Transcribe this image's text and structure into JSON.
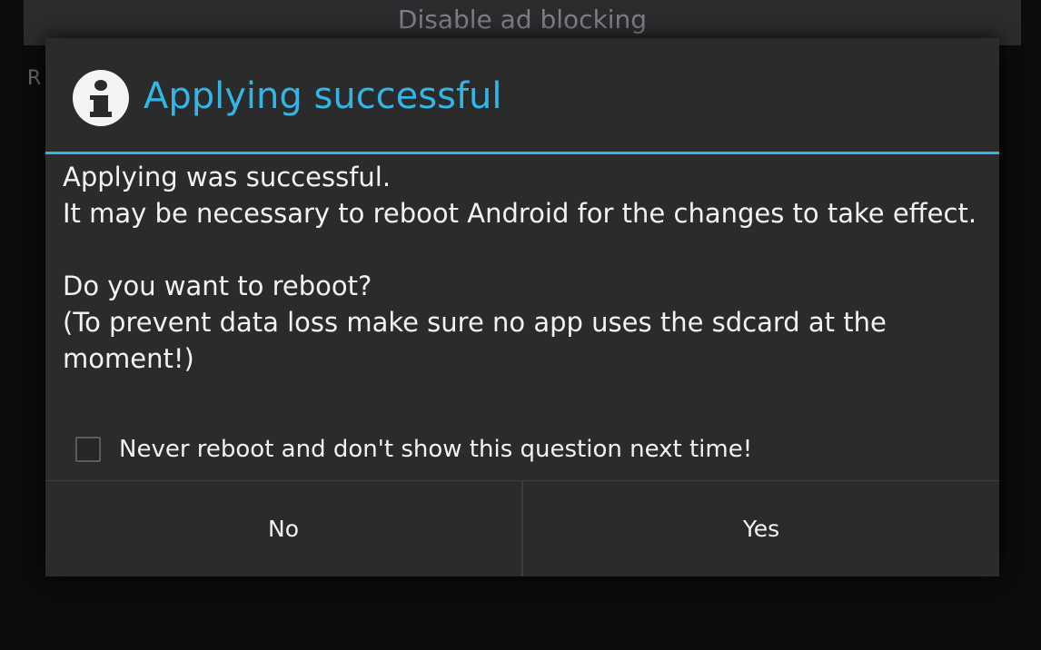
{
  "background": {
    "top_button_label": "Disable ad blocking",
    "partial_label": "R"
  },
  "dialog": {
    "icon": "info-icon",
    "title": "Applying successful",
    "accent_color": "#33b5e5",
    "message_lines": [
      "Applying was successful.",
      "It may be necessary to reboot Android for the changes to take effect.",
      "Do you want to reboot?",
      "(To prevent data loss make sure no app uses the sdcard at the moment!)"
    ],
    "checkbox": {
      "label": "Never reboot and don't show this question next time!",
      "checked": false
    },
    "buttons": {
      "no": "No",
      "yes": "Yes"
    }
  }
}
